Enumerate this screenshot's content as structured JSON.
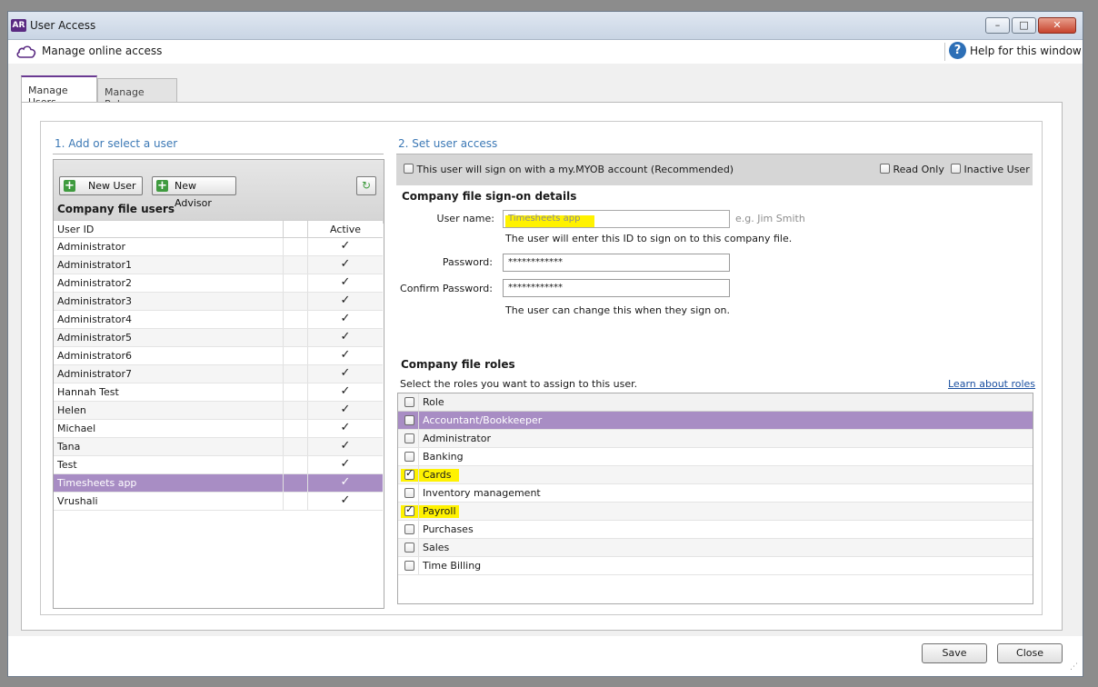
{
  "window": {
    "app_badge": "AR",
    "title": "User Access",
    "controls": {
      "minimize": "–",
      "maximize": "□",
      "close": "✕"
    }
  },
  "header": {
    "manage_label": "Manage online access",
    "help_symbol": "?",
    "help_label": "Help for this window"
  },
  "tabs": [
    {
      "label": "Manage Users",
      "active": true
    },
    {
      "label": "Manage Roles",
      "active": false
    }
  ],
  "left": {
    "section_title": "1. Add or select a user",
    "new_user_label": "New User",
    "new_advisor_label": "New Advisor",
    "refresh_icon": "↻",
    "users_heading": "Company file users",
    "col_user_id": "User ID",
    "col_active": "Active",
    "check_glyph": "✓",
    "users": [
      {
        "id": "Administrator",
        "active": true
      },
      {
        "id": "Administrator1",
        "active": true
      },
      {
        "id": "Administrator2",
        "active": true
      },
      {
        "id": "Administrator3",
        "active": true
      },
      {
        "id": "Administrator4",
        "active": true
      },
      {
        "id": "Administrator5",
        "active": true
      },
      {
        "id": "Administrator6",
        "active": true
      },
      {
        "id": "Administrator7",
        "active": true
      },
      {
        "id": "Hannah Test",
        "active": true
      },
      {
        "id": "Helen",
        "active": true
      },
      {
        "id": "Michael",
        "active": true
      },
      {
        "id": "Tana",
        "active": true
      },
      {
        "id": "Test",
        "active": true
      },
      {
        "id": "Timesheets app",
        "active": true,
        "selected": true
      },
      {
        "id": "Vrushali",
        "active": true
      }
    ]
  },
  "right": {
    "section_title": "2. Set user access",
    "myob_signon_label": "This user will sign on with a my.MYOB account (Recommended)",
    "read_only_label": "Read Only",
    "inactive_user_label": "Inactive User",
    "signon_heading": "Company file sign-on details",
    "username_label": "User name:",
    "username_value": "Timesheets app",
    "username_example": "e.g. Jim Smith",
    "username_hint": "The user will enter this ID to sign on to this company file.",
    "password_label": "Password:",
    "password_value": "************",
    "confirm_label": "Confirm Password:",
    "confirm_value": "************",
    "password_hint": "The user can change this when they sign on.",
    "roles_heading": "Company file roles",
    "roles_instruction": "Select the roles you want to assign to this user.",
    "learn_roles_link": "Learn about roles",
    "roles_header": "Role",
    "roles": [
      {
        "name": "Accountant/Bookkeeper",
        "checked": false,
        "selected": true
      },
      {
        "name": "Administrator",
        "checked": false
      },
      {
        "name": "Banking",
        "checked": false
      },
      {
        "name": "Cards",
        "checked": true
      },
      {
        "name": "Inventory management",
        "checked": false
      },
      {
        "name": "Payroll",
        "checked": true
      },
      {
        "name": "Purchases",
        "checked": false
      },
      {
        "name": "Sales",
        "checked": false
      },
      {
        "name": "Time Billing",
        "checked": false
      }
    ]
  },
  "footer": {
    "save_label": "Save",
    "close_label": "Close"
  },
  "colors": {
    "selection": "#a88dc4",
    "accent_purple": "#6a3a92",
    "highlight": "#fff200",
    "section_title_blue": "#3b78b5"
  }
}
